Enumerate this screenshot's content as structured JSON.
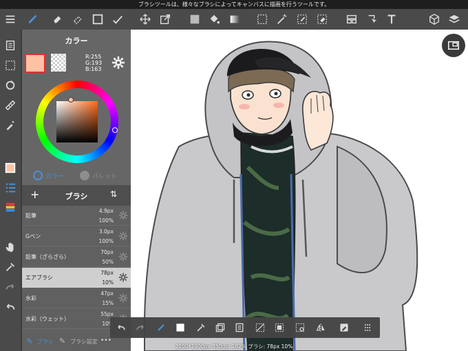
{
  "status_bar": {
    "text": "ブラシツールは、様々なブラシによってキャンバスに描画を行うツールです。"
  },
  "color_panel": {
    "title": "カラー",
    "foreground": "#ffc1a3",
    "r": "R:255",
    "g": "G:193",
    "b": "B:163",
    "tabs": [
      "カラー",
      "パレット"
    ]
  },
  "brush_panel": {
    "title": "ブラシ",
    "brushes": [
      {
        "name": "鉛筆",
        "size": "4.9px",
        "opacity": "100%",
        "selected": false
      },
      {
        "name": "Gペン",
        "size": "3.0px",
        "opacity": "100%",
        "selected": false
      },
      {
        "name": "鉛筆（ざらざら）",
        "size": "70px",
        "opacity": "50%",
        "selected": false
      },
      {
        "name": "エアブラシ",
        "size": "78px",
        "opacity": "10%",
        "selected": true
      },
      {
        "name": "水彩",
        "size": "47px",
        "opacity": "15%",
        "selected": false
      },
      {
        "name": "水彩（ウェット）",
        "size": "55px",
        "opacity": "10%",
        "selected": false
      }
    ],
    "footer": {
      "brush_tab": "ブラシ",
      "settings_tab": "ブラシ設定",
      "more": "•••"
    }
  },
  "canvas_status": "1200*1900px 350dpi 182% ブラシ: 78px 10%",
  "colors": {
    "accent": "#4a90d9",
    "selected_swatch_border": "#e0312a"
  },
  "icons": {
    "top_toolbar": [
      "menu-icon",
      "brush-icon",
      "eraser-icon",
      "lasso-eraser-icon",
      "rectangle-icon",
      "check-pen-icon",
      "move-icon",
      "transform-icon",
      "fill-color-icon",
      "bucket-icon",
      "gradient-icon",
      "select-icon",
      "magic-wand-icon",
      "select-pen-icon",
      "select-eraser-icon",
      "frame-icon",
      "operation-icon",
      "text-icon",
      "3d-cube-icon",
      "layers-icon"
    ],
    "left_toolbar": [
      "page-icon",
      "selection-icon",
      "rotate-icon",
      "ruler-icon",
      "spray-icon",
      "color-icon",
      "brush-list-icon",
      "layer-icon",
      "hand-icon",
      "eyedropper-icon",
      "redo-icon",
      "undo-icon"
    ],
    "bottom_toolbar": [
      "undo-icon",
      "redo-icon",
      "brush-swap-icon",
      "color-swatch-icon",
      "eyedropper-icon",
      "copy-icon",
      "paste-icon",
      "deselect-icon",
      "invert-selection-icon",
      "select-all-icon",
      "flip-icon",
      "pen-icon",
      "grid-icon"
    ]
  }
}
